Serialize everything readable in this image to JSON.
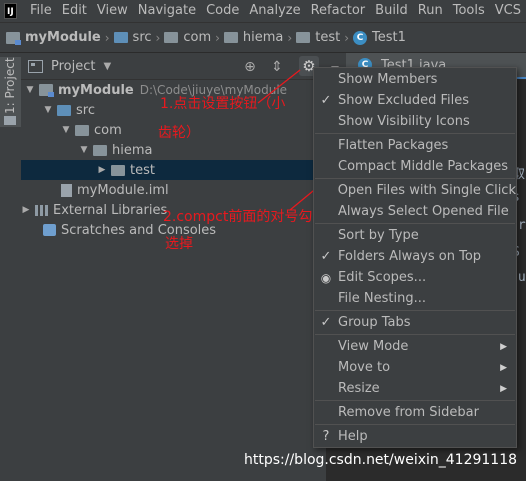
{
  "menubar": {
    "app_logo": "IJ",
    "items": [
      "File",
      "Edit",
      "View",
      "Navigate",
      "Code",
      "Analyze",
      "Refactor",
      "Build",
      "Run",
      "Tools",
      "VCS"
    ]
  },
  "breadcrumbs": [
    "myModule",
    "src",
    "com",
    "hiema",
    "test",
    "Test1"
  ],
  "left_strip": {
    "tab_label": "1: Project"
  },
  "project_panel": {
    "title": "Project",
    "gear_tooltip_icon": "gear-icon"
  },
  "editor_tab": {
    "label": "Test1.java"
  },
  "tree": {
    "root_name": "myModule",
    "root_path": "D:\\Code\\jiuye\\myModule",
    "src": "src",
    "com": "com",
    "hiema": "hiema",
    "test": "test",
    "iml": "myModule.iml",
    "external_libs": "External Libraries",
    "scratches": "Scratches and Consoles"
  },
  "editor_fragments": [
    "取",
    "s",
    "ar",
    "S",
    "tu"
  ],
  "popup_menu": {
    "show_members": "Show Members",
    "show_excluded_files": "Show Excluded Files",
    "show_visibility_icons": "Show Visibility Icons",
    "flatten_packages": "Flatten Packages",
    "compact_middle_packages": "Compact Middle Packages",
    "open_files_single_click": "Open Files with Single Click",
    "always_select_opened_file": "Always Select Opened File",
    "sort_by_type": "Sort by Type",
    "folders_always_on_top": "Folders Always on Top",
    "edit_scopes": "Edit Scopes...",
    "file_nesting": "File Nesting...",
    "group_tabs": "Group Tabs",
    "view_mode": "View Mode",
    "move_to": "Move to",
    "resize": "Resize",
    "remove_from_sidebar": "Remove from Sidebar",
    "help": "Help"
  },
  "annotations": {
    "step1_line1": "1.点击设置按钮（小",
    "step1_line2": "齿轮）",
    "step2_line1": "2.compct前面的对号勾",
    "step2_line2": "选掉"
  },
  "watermark": "https://blog.csdn.net/weixin_41291118",
  "colors": {
    "accent": "#4a88c7",
    "annotation_red": "#e8191e",
    "selection": "#0d293e"
  }
}
